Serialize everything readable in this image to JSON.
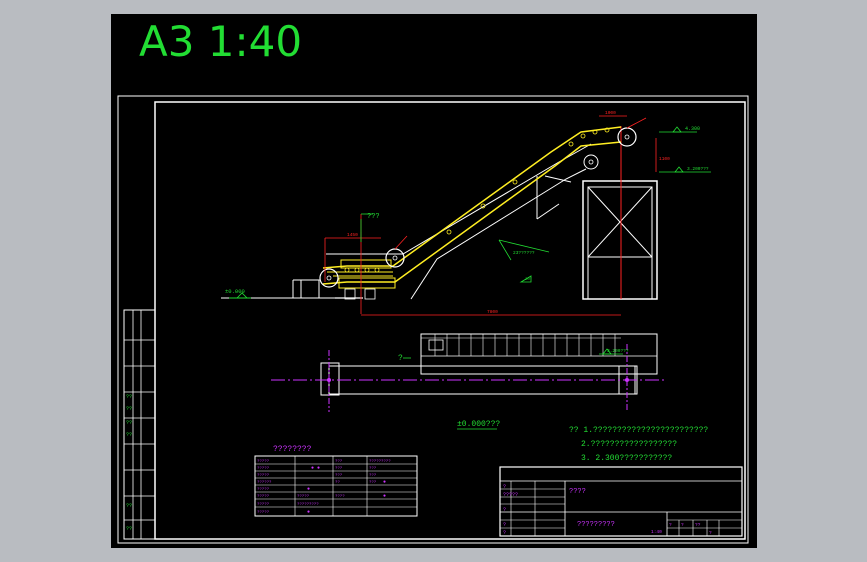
{
  "sheet": {
    "title_text": "A3 1:40"
  },
  "elevation": {
    "ground_label": "±0.000",
    "top_label": "4.300",
    "level_label": "3.200???",
    "dim_top": "1000",
    "dim_right": "1100",
    "dim_left": "1450",
    "dim_span": "7800",
    "callout": "???",
    "slope_label": "23??????",
    "angle_label": "20°"
  },
  "plan": {
    "plan_level": "3.200???",
    "plan_mark": "?"
  },
  "ground_note": "±0.000???",
  "notes": [
    "?? 1.????????????????????????",
    "2.??????????????????",
    "3. 2.300???????????"
  ],
  "table": {
    "title": "????????",
    "rows": [
      [
        "?????",
        "",
        "???",
        "",
        "?????????"
      ],
      [
        "?????",
        "",
        "???",
        "???",
        ""
      ],
      [
        "?????",
        "",
        "???",
        "???",
        ""
      ],
      [
        "??????",
        "",
        "??",
        "???",
        ""
      ],
      [
        "?????",
        "",
        "?????",
        "????",
        ""
      ],
      [
        "?????",
        "",
        "?????????",
        "",
        ""
      ],
      [
        "?????",
        "",
        "",
        "",
        ""
      ],
      [
        "?????",
        "",
        "",
        "",
        ""
      ]
    ]
  },
  "title_block": {
    "name": "????",
    "drawing_name": "?????????",
    "scale": "1:40",
    "left_cells": [
      "?",
      "?????",
      "?",
      "?",
      "?"
    ],
    "right_cells": [
      "?",
      "?",
      "??",
      "?"
    ]
  },
  "left_strip": {
    "cells": [
      "??",
      "??",
      "??",
      "??",
      "??",
      "??"
    ]
  }
}
